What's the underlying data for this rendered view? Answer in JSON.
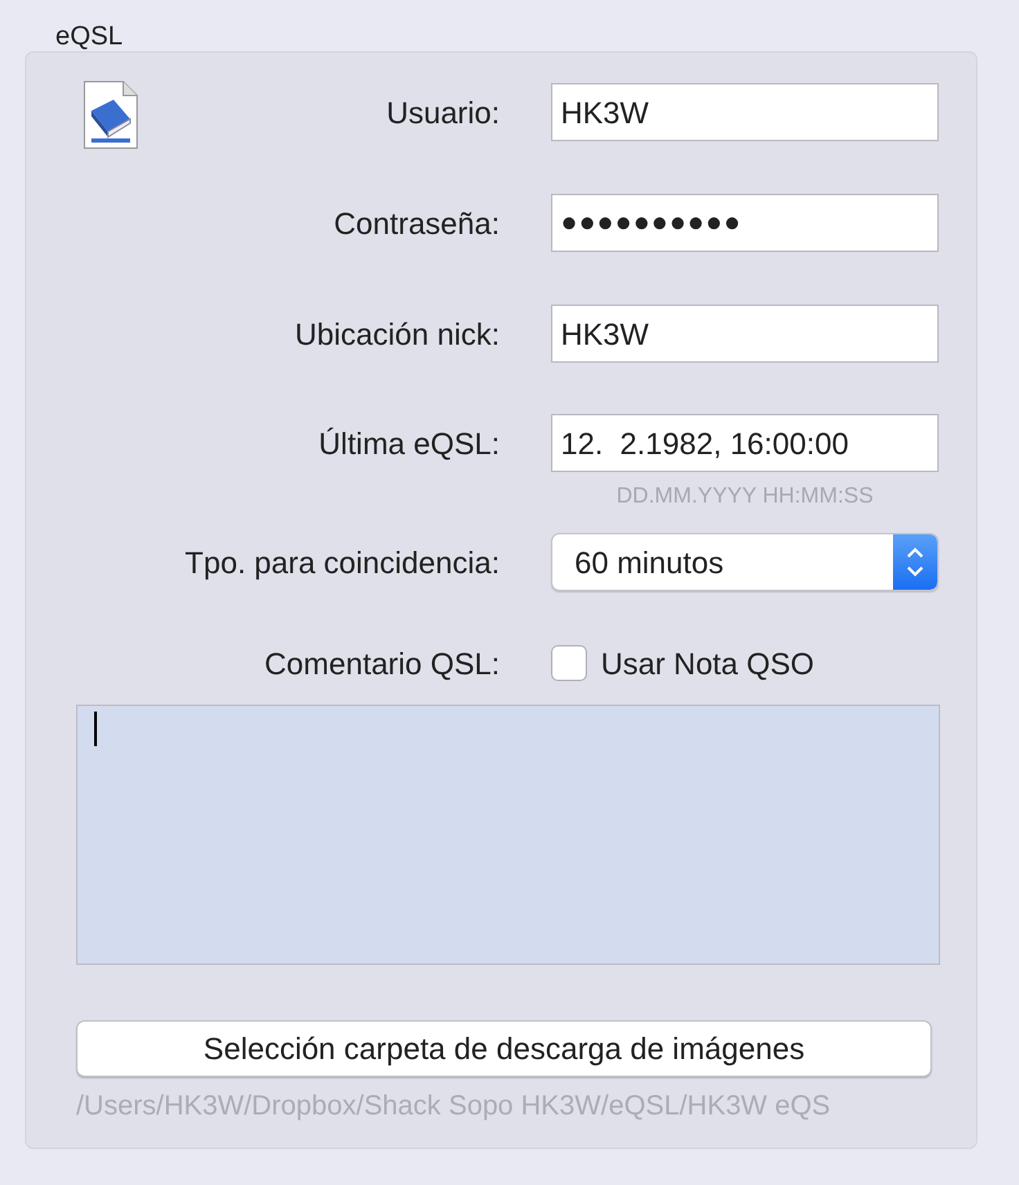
{
  "group_title": "eQSL",
  "fields": [
    {
      "label": "Usuario:",
      "kind": "text",
      "value": "HK3W"
    },
    {
      "label": "Contraseña:",
      "kind": "password",
      "value": "●●●●●●●●●●"
    },
    {
      "label": "Ubicación nick:",
      "kind": "text",
      "value": "HK3W"
    },
    {
      "label": "Última eQSL:",
      "kind": "text",
      "value": "12.  2.1982, 16:00:00",
      "hint": "DD.MM.YYYY HH:MM:SS"
    },
    {
      "label": "Tpo. para coincidencia:",
      "kind": "select",
      "value": "60 minutos"
    }
  ],
  "comment": {
    "label": "Comentario QSL:",
    "checkbox_label": "Usar Nota QSO",
    "checked": false
  },
  "folder_button": "Selección carpeta de descarga de imágenes",
  "folder_path": "/Users/HK3W/Dropbox/Shack Sopo HK3W/eQSL/HK3W eQS"
}
